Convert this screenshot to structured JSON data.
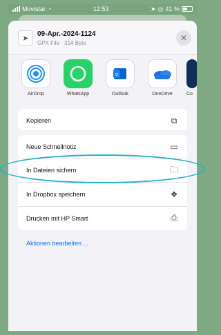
{
  "status": {
    "carrier": "Movistar",
    "time": "12:53",
    "battery": "41 %"
  },
  "file": {
    "name": "09-Apr.-2024-1124",
    "meta": "GPX File · 314 Byte"
  },
  "apps": [
    {
      "label": "AirDrop",
      "icon": "airdrop-icon"
    },
    {
      "label": "WhatsApp",
      "icon": "whatsapp-icon"
    },
    {
      "label": "Outlook",
      "icon": "outlook-icon"
    },
    {
      "label": "OneDrive",
      "icon": "onedrive-icon"
    },
    {
      "label": "Co",
      "icon": "partial-app-icon"
    }
  ],
  "actions": {
    "copy": {
      "label": "Kopieren",
      "icon": "copy-icon"
    },
    "list": [
      {
        "label": "Neue Schnellnotiz",
        "icon": "quick-note-icon"
      },
      {
        "label": "In Dateien sichern",
        "icon": "folder-icon"
      },
      {
        "label": "In Dropbox speichern",
        "icon": "dropbox-icon"
      },
      {
        "label": "Drucken mit HP Smart",
        "icon": "print-icon"
      }
    ],
    "edit_link": "Aktionen bearbeiten ..."
  },
  "colors": {
    "background": "#7fa982",
    "accent": "#0a72ff",
    "annotation": "#1eb3c7"
  }
}
